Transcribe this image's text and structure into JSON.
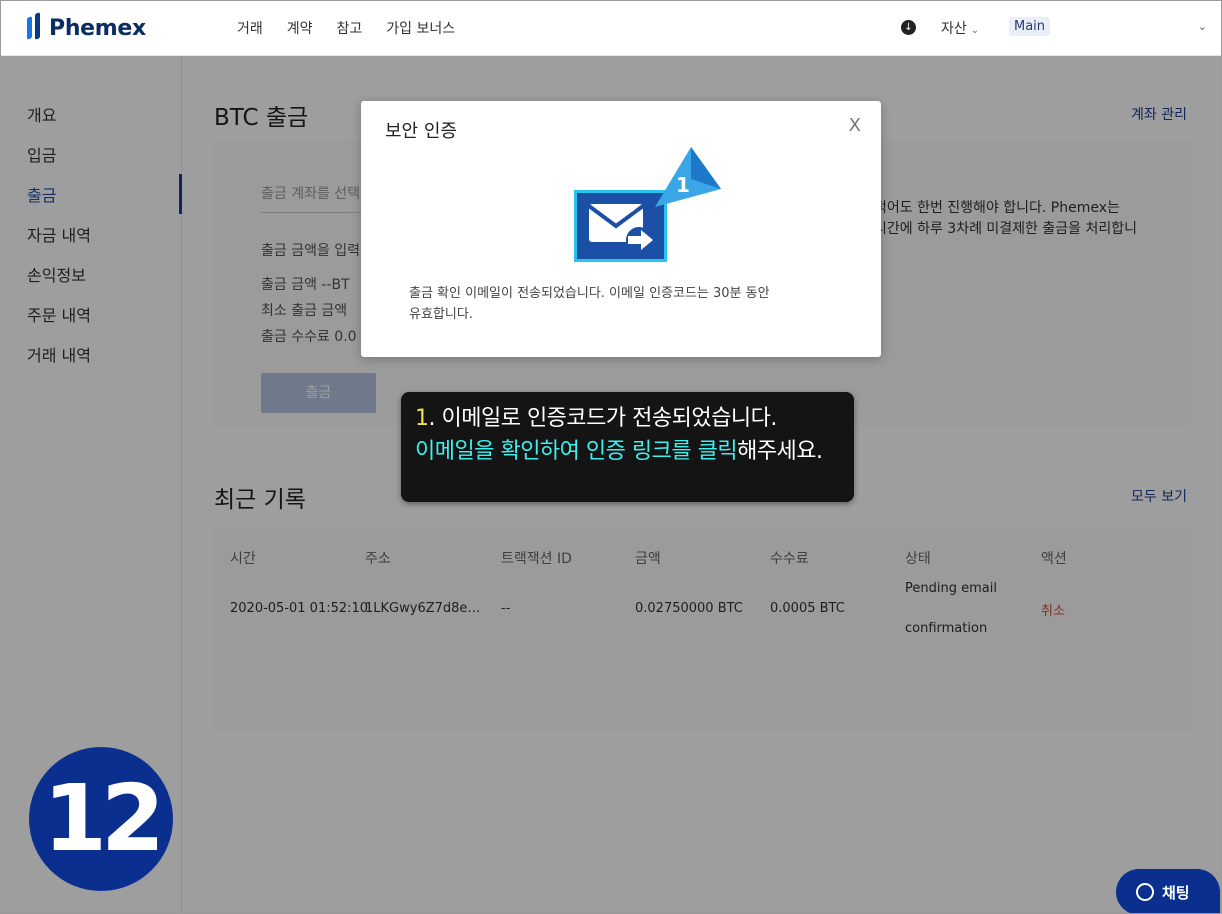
{
  "header": {
    "brand": "Phemex",
    "nav": [
      "거래",
      "계약",
      "참고",
      "가입 보너스"
    ],
    "assets_label": "자산",
    "account_badge": "Main"
  },
  "sidebar": {
    "items": [
      "개요",
      "입금",
      "출금",
      "자금 내역",
      "손익정보",
      "주문 내역",
      "거래 내역"
    ],
    "active": "출금"
  },
  "withdraw": {
    "title": "BTC 출금",
    "account_manage": "계좌 관리",
    "account_placeholder": "출금 계좌를 선택",
    "amount_placeholder": "출금 금액을 입력",
    "amount_row": "출금 금액   --BT",
    "min_amount_label": "최소 출금 금액",
    "fee_row": "출금 수수료   0.0",
    "button": "출금",
    "notice_line1": "적어도 한번 진행해야 합니다. Phemex는",
    "notice_line2": "시간에 하루 3차례 미결제한 출금을 처리합니"
  },
  "history": {
    "title": "최근 기록",
    "view_all": "모두 보기",
    "columns": [
      "시간",
      "주소",
      "트랙잭션 ID",
      "금액",
      "수수료",
      "상태",
      "액션"
    ],
    "rows": [
      {
        "time": "2020-05-01 01:52:10",
        "address": "1LKGwy6Z7d8e…",
        "txid": "--",
        "amount": "0.02750000 BTC",
        "fee": "0.0005 BTC",
        "status_line1": "Pending email",
        "status_line2": "confirmation",
        "action": "취소"
      }
    ]
  },
  "modal": {
    "title": "보안 인증",
    "close": "X",
    "message_line1": "출금 확인 이메일이 전송되었습니다. 이메일 인증코드는 30분 동안",
    "message_line2": "유효합니다."
  },
  "callout": {
    "marker": "1",
    "number": "1",
    "line1": ". 이메일로 인증코드가 전송되었습니다.",
    "line2_highlight": "이메일을 확인하여 인증 링크를 클릭",
    "line2_rest": "해주세요."
  },
  "step_badge": "12",
  "chat": {
    "label": "채팅"
  },
  "colors": {
    "brand_navy": "#0a2f8f",
    "link_blue": "#1f3e8a",
    "callout_highlight": "#3ef0ee",
    "callout_number": "#f2e34b",
    "cancel_red": "#d84a3f"
  }
}
